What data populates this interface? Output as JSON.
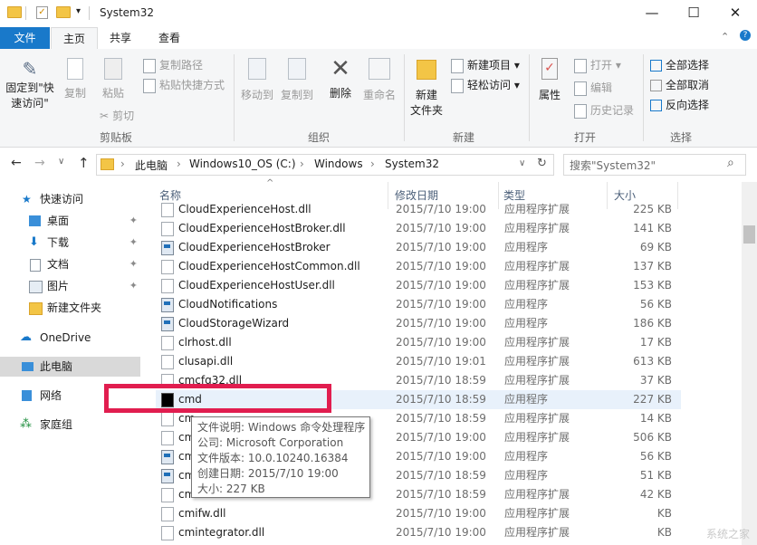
{
  "window": {
    "title": "System32",
    "min_glyph": "—",
    "max_glyph": "☐",
    "close_glyph": "✕",
    "qa_dropdown": "▾",
    "help_glyph": "?",
    "ribbon_toggle": "⌃"
  },
  "tabs": {
    "file": "文件",
    "home": "主页",
    "share": "共享",
    "view": "查看"
  },
  "ribbon": {
    "groups": {
      "clipboard": "剪贴板",
      "organize": "组织",
      "new": "新建",
      "open": "打开",
      "select": "选择"
    },
    "pin_label_1": "固定到\"快",
    "pin_label_2": "速访问\"",
    "copy": "复制",
    "paste": "粘贴",
    "copy_path": "复制路径",
    "paste_shortcut": "粘贴快捷方式",
    "cut": "剪切",
    "move_to": "移动到",
    "copy_to": "复制到",
    "delete": "删除",
    "rename": "重命名",
    "new_folder_1": "新建",
    "new_folder_2": "文件夹",
    "new_item": "新建项目",
    "easy_access": "轻松访问",
    "properties": "属性",
    "open": "打开",
    "edit": "编辑",
    "history": "历史记录",
    "select_all": "全部选择",
    "select_none": "全部取消",
    "invert_select": "反向选择"
  },
  "address": {
    "back": "←",
    "forward": "→",
    "recent": "∨",
    "up": "↑",
    "separator": "›",
    "crumbs": [
      "此电脑",
      "Windows10_OS (C:)",
      "Windows",
      "System32"
    ],
    "dropdown": "∨",
    "refresh": "↻",
    "search_placeholder": "搜索\"System32\"",
    "search_glyph": "⌕"
  },
  "nav": {
    "quick_access": "快速访问",
    "desktop": "桌面",
    "downloads": "下载",
    "documents": "文档",
    "pictures": "图片",
    "new_folder": "新建文件夹",
    "onedrive": "OneDrive",
    "this_pc": "此电脑",
    "network": "网络",
    "homegroup": "家庭组",
    "pin_glyph": "✦"
  },
  "columns": {
    "name": "名称",
    "date": "修改日期",
    "type": "类型",
    "size": "大小",
    "sort_glyph": "^"
  },
  "files": [
    {
      "name": "CloudExperienceHost.dll",
      "date": "2015/7/10 19:00",
      "type": "应用程序扩展",
      "size": "225 KB",
      "icon": "dll"
    },
    {
      "name": "CloudExperienceHostBroker.dll",
      "date": "2015/7/10 19:00",
      "type": "应用程序扩展",
      "size": "141 KB",
      "icon": "dll"
    },
    {
      "name": "CloudExperienceHostBroker",
      "date": "2015/7/10 19:00",
      "type": "应用程序",
      "size": "69 KB",
      "icon": "exe"
    },
    {
      "name": "CloudExperienceHostCommon.dll",
      "date": "2015/7/10 19:00",
      "type": "应用程序扩展",
      "size": "137 KB",
      "icon": "dll"
    },
    {
      "name": "CloudExperienceHostUser.dll",
      "date": "2015/7/10 19:00",
      "type": "应用程序扩展",
      "size": "153 KB",
      "icon": "dll"
    },
    {
      "name": "CloudNotifications",
      "date": "2015/7/10 19:00",
      "type": "应用程序",
      "size": "56 KB",
      "icon": "exe"
    },
    {
      "name": "CloudStorageWizard",
      "date": "2015/7/10 19:00",
      "type": "应用程序",
      "size": "186 KB",
      "icon": "exe"
    },
    {
      "name": "clrhost.dll",
      "date": "2015/7/10 19:00",
      "type": "应用程序扩展",
      "size": "17 KB",
      "icon": "dll"
    },
    {
      "name": "clusapi.dll",
      "date": "2015/7/10 19:01",
      "type": "应用程序扩展",
      "size": "613 KB",
      "icon": "dll"
    },
    {
      "name": "cmcfg32.dll",
      "date": "2015/7/10 18:59",
      "type": "应用程序扩展",
      "size": "37 KB",
      "icon": "dll"
    },
    {
      "name": "cmd",
      "date": "2015/7/10 18:59",
      "type": "应用程序",
      "size": "227 KB",
      "icon": "cmd"
    },
    {
      "name": "cm",
      "date": "2015/7/10 18:59",
      "type": "应用程序扩展",
      "size": "14 KB",
      "icon": "dll"
    },
    {
      "name": "cm",
      "date": "2015/7/10 19:00",
      "type": "应用程序扩展",
      "size": "506 KB",
      "icon": "dll"
    },
    {
      "name": "cm",
      "date": "2015/7/10 19:00",
      "type": "应用程序",
      "size": "56 KB",
      "icon": "exe"
    },
    {
      "name": "cm",
      "date": "2015/7/10 18:59",
      "type": "应用程序",
      "size": "51 KB",
      "icon": "exe"
    },
    {
      "name": "cm",
      "date": "2015/7/10 18:59",
      "type": "应用程序扩展",
      "size": "42 KB",
      "icon": "dll"
    },
    {
      "name": "cmifw.dll",
      "date": "2015/7/10 19:00",
      "type": "应用程序扩展",
      "size": "KB",
      "icon": "dll"
    },
    {
      "name": "cmintegrator.dll",
      "date": "2015/7/10 19:00",
      "type": "应用程序扩展",
      "size": "KB",
      "icon": "dll"
    }
  ],
  "tooltip": {
    "desc": "文件说明: Windows 命令处理程序",
    "company": "公司: Microsoft Corporation",
    "version": "文件版本: 10.0.10240.16384",
    "created": "创建日期: 2015/7/10 19:00",
    "size": "大小: 227 KB"
  },
  "watermark": "系统之家"
}
